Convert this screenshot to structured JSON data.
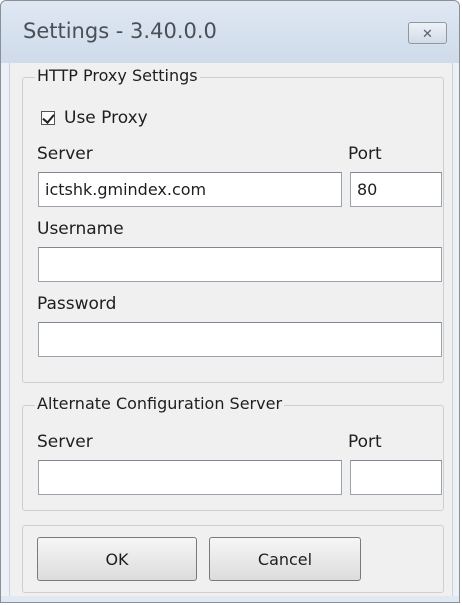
{
  "window": {
    "title": "Settings - 3.40.0.0",
    "close_icon": "close-icon"
  },
  "http_proxy": {
    "group_title": "HTTP Proxy Settings",
    "use_proxy_label": "Use Proxy",
    "use_proxy_checked": true,
    "server_label": "Server",
    "server_value": "ictshk.gmindex.com",
    "port_label": "Port",
    "port_value": "80",
    "username_label": "Username",
    "username_value": "",
    "password_label": "Password",
    "password_value": ""
  },
  "alternate_config": {
    "group_title": "Alternate Configuration Server",
    "server_label": "Server",
    "server_value": "",
    "port_label": "Port",
    "port_value": ""
  },
  "buttons": {
    "ok_label": "OK",
    "cancel_label": "Cancel"
  }
}
